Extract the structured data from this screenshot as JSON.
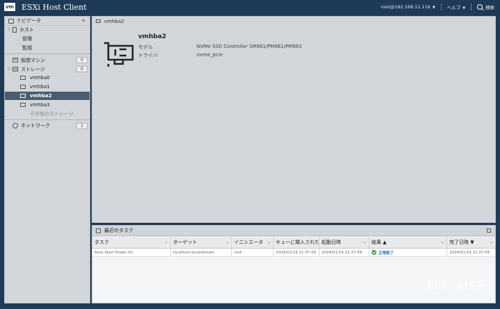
{
  "header": {
    "logo": "vm",
    "title": "ESXi Host Client",
    "user": "root@192.168.11.116",
    "help": "ヘルプ",
    "search": "検索"
  },
  "navigator": {
    "title": "ナビゲータ",
    "host": "ホスト",
    "host_children": [
      "管理",
      "監視"
    ],
    "vms": {
      "label": "仮想マシン",
      "count": "0"
    },
    "storage": {
      "label": "ストレージ",
      "count": "0"
    },
    "storage_children": [
      "vmhba0",
      "vmhba1",
      "vmhba2",
      "vmhba3",
      "その他のストレージ"
    ],
    "network": {
      "label": "ネットワーク",
      "count": "1"
    }
  },
  "detail": {
    "breadcrumb": "vmhba2",
    "title": "vmhba2",
    "model_label": "モデル",
    "model_value": "NVMe SSD Controller SM981/PM981/PM983",
    "driver_label": "ドライバ",
    "driver_value": "nvme_pcie"
  },
  "tasks": {
    "title": "最近のタスク",
    "columns": [
      "タスク",
      "ターゲット",
      "イニシエータ",
      "キューに挿入された日",
      "起動日時",
      "結果 ▲",
      "完了日時 ▼"
    ],
    "rows": [
      {
        "task": "Auto Start Power On",
        "target": "localhost.localdomain",
        "initiator": "root",
        "queued": "2024/01/19 21:37:58",
        "started": "2024/01/19 21:37:58",
        "result": "正常終了",
        "completed": "2024/01/19 21:37:58"
      }
    ]
  },
  "watermark": "知乎 @钱乎"
}
